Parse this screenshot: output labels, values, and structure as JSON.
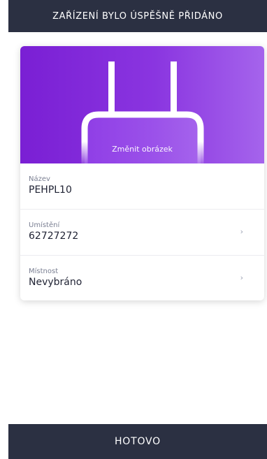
{
  "header": {
    "title": "ZAŘÍZENÍ BYLO ÚSPĚŠNĚ PŘIDÁNO"
  },
  "device_card": {
    "image_icon": "router-icon",
    "change_image_label": "Změnit obrázek",
    "fields": [
      {
        "label": "Název",
        "value": "PEHPL10",
        "has_chevron": false
      },
      {
        "label": "Umístění",
        "value": "62727272",
        "has_chevron": true
      },
      {
        "label": "Místnost",
        "value": "Nevybráno",
        "has_chevron": true
      }
    ],
    "chevron_glyph": "›"
  },
  "footer": {
    "done_label": "HOTOVO"
  },
  "colors": {
    "bar_background": "#2b3042",
    "hero_gradient_start": "#7a1fd4",
    "hero_gradient_end": "#a564ec"
  }
}
